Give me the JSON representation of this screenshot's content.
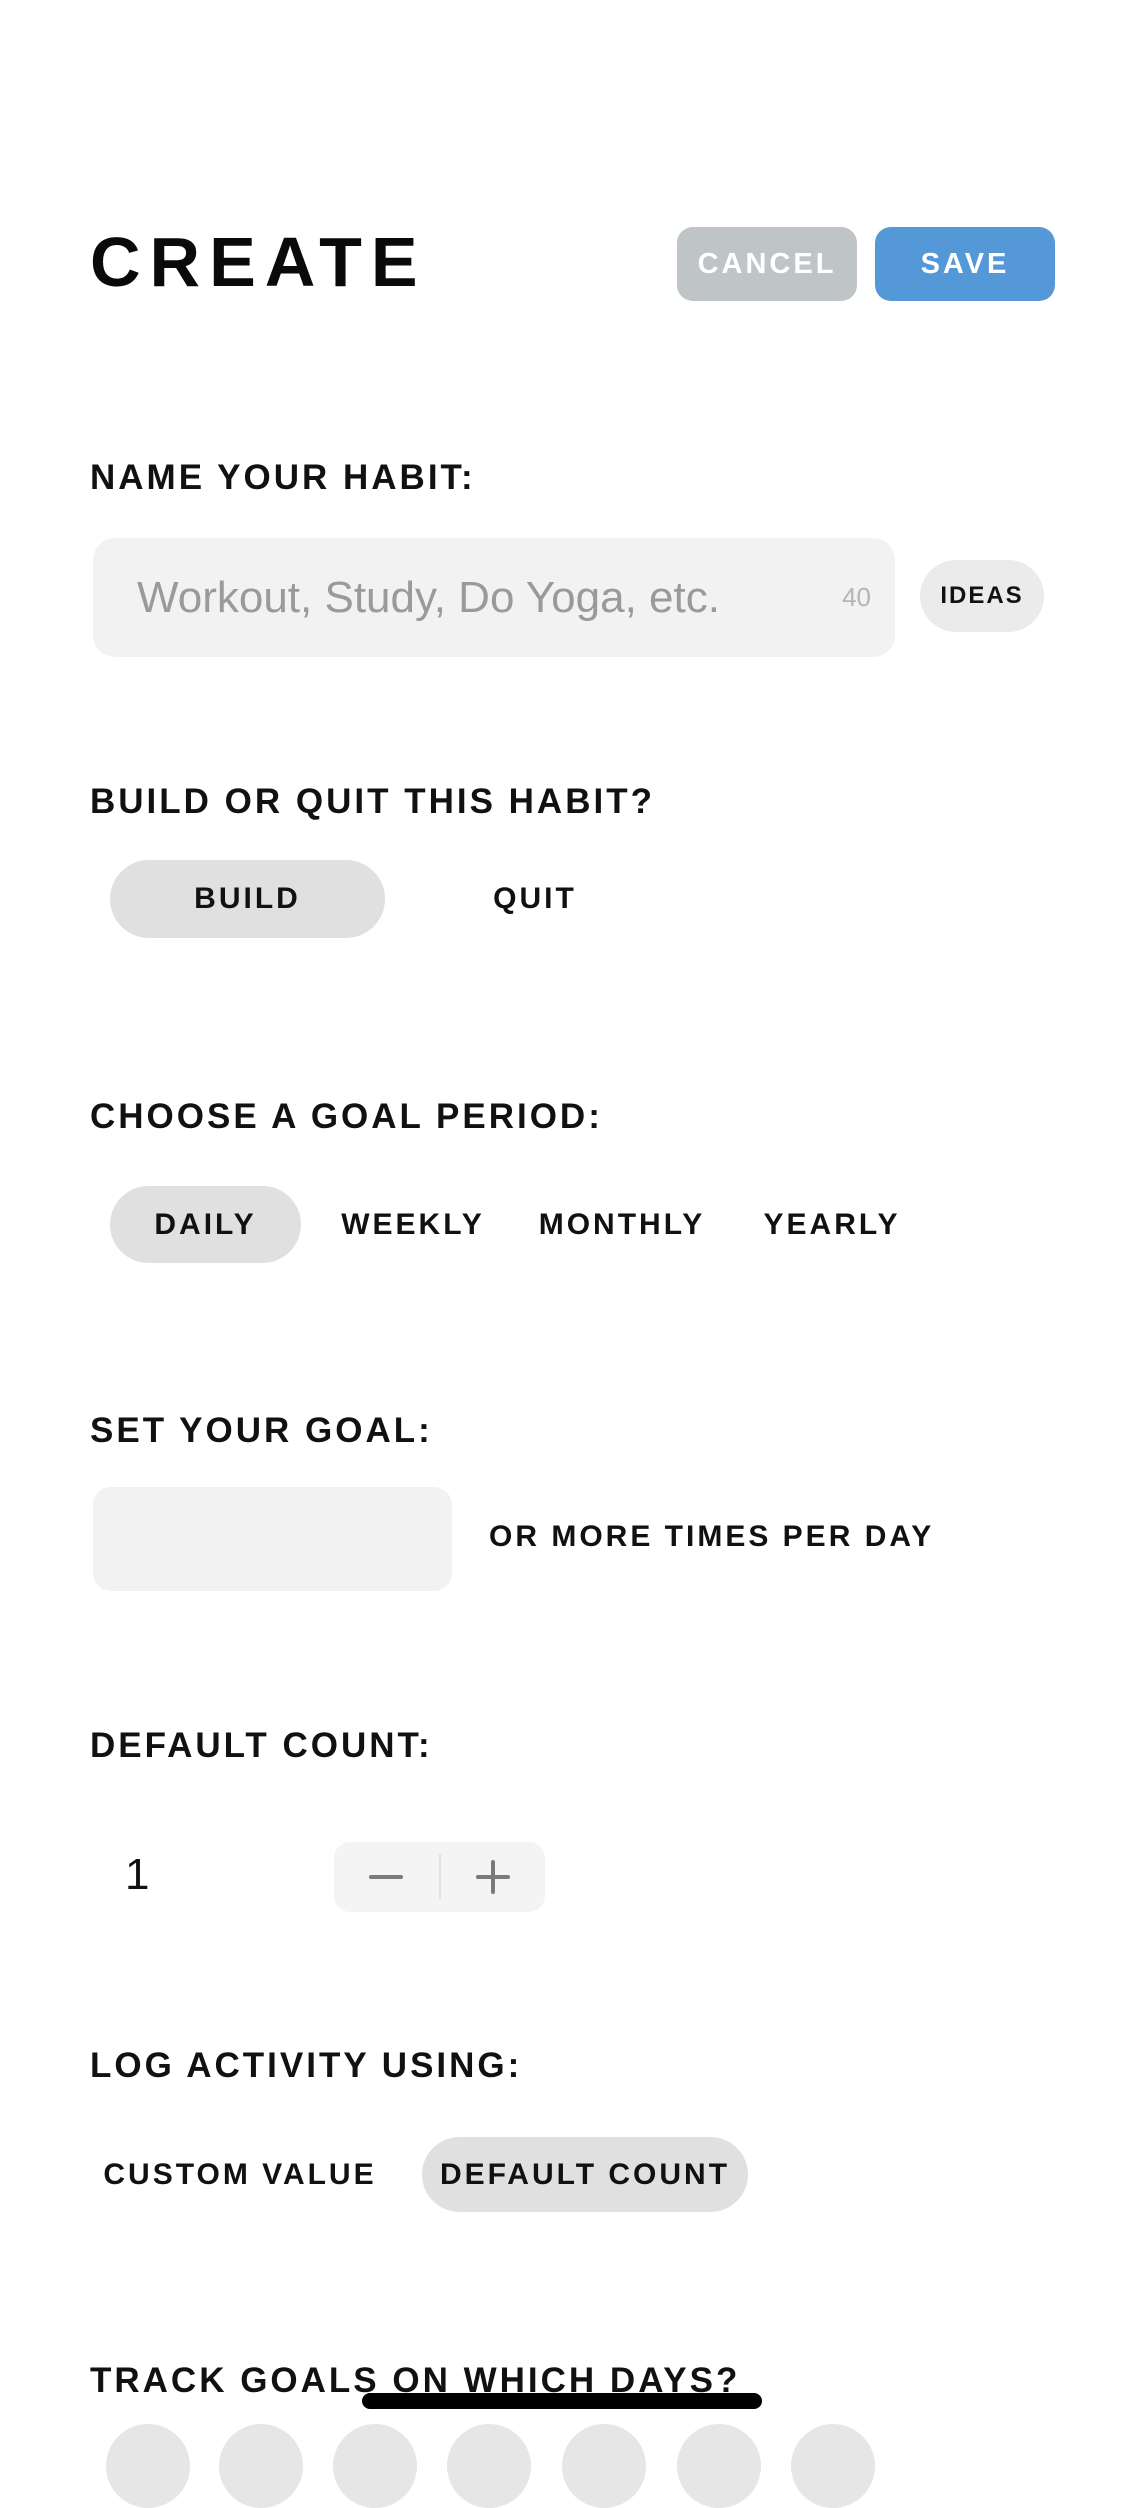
{
  "header": {
    "title": "CREATE",
    "cancel_label": "CANCEL",
    "save_label": "SAVE",
    "colors": {
      "cancel": "#bfc4c6",
      "save": "#5598d7"
    }
  },
  "name_section": {
    "label": "NAME YOUR HABIT:",
    "input_value": "",
    "placeholder": "Workout, Study, Do Yoga, etc.",
    "char_limit": "40",
    "ideas_label": "IDEAS"
  },
  "build_quit": {
    "label": "BUILD OR QUIT THIS HABIT?",
    "options": [
      "BUILD",
      "QUIT"
    ],
    "selected": "BUILD"
  },
  "goal_period": {
    "label": "CHOOSE A GOAL PERIOD:",
    "options": [
      "DAILY",
      "WEEKLY",
      "MONTHLY",
      "YEARLY"
    ],
    "selected": "DAILY"
  },
  "goal": {
    "label": "SET YOUR GOAL:",
    "input_value": "",
    "suffix": "OR MORE TIMES PER DAY"
  },
  "default_count": {
    "label": "DEFAULT COUNT:",
    "value": "1",
    "decrement_icon": "minus-icon",
    "increment_icon": "plus-icon"
  },
  "log_activity": {
    "label": "LOG ACTIVITY USING:",
    "options": [
      "CUSTOM VALUE",
      "DEFAULT COUNT"
    ],
    "selected": "DEFAULT COUNT"
  },
  "track_days": {
    "label": "TRACK GOALS ON WHICH DAYS?",
    "day_count": 7
  }
}
